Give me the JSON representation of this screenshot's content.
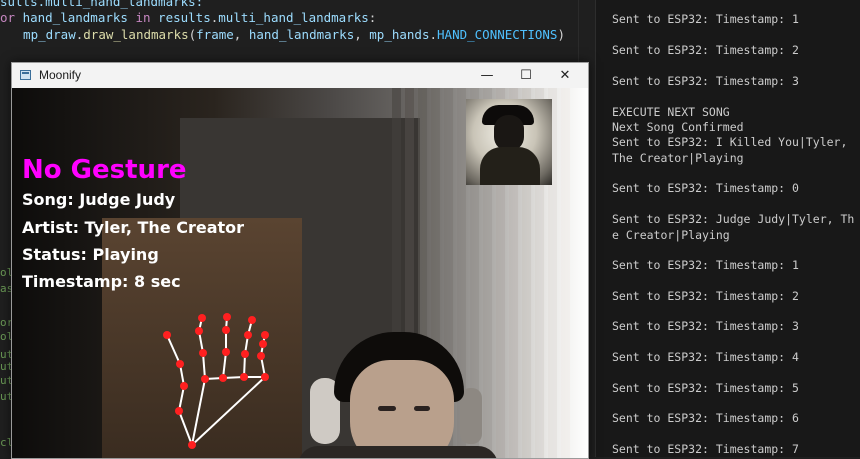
{
  "editor": {
    "lines": [
      {
        "parts": [
          {
            "t": "sults.multi_hand_landmarks:",
            "c": "vr"
          }
        ]
      },
      {
        "parts": [
          {
            "t": "or ",
            "c": "kw"
          },
          {
            "t": "hand_landmarks",
            "c": "vr"
          },
          {
            "t": " in ",
            "c": "kw"
          },
          {
            "t": "results",
            "c": "vr"
          },
          {
            "t": ".",
            "c": ""
          },
          {
            "t": "multi_hand_landmarks",
            "c": "vr"
          },
          {
            "t": ":",
            "c": ""
          }
        ]
      },
      {
        "parts": [
          {
            "t": "  mp_draw",
            "c": "vr"
          },
          {
            "t": ".",
            "c": ""
          },
          {
            "t": "draw_landmarks",
            "c": "fn"
          },
          {
            "t": "(",
            "c": ""
          },
          {
            "t": "frame",
            "c": "vr"
          },
          {
            "t": ", ",
            "c": ""
          },
          {
            "t": "hand_landmarks",
            "c": "vr"
          },
          {
            "t": ", ",
            "c": ""
          },
          {
            "t": "mp_hands",
            "c": "vr"
          },
          {
            "t": ".",
            "c": ""
          },
          {
            "t": "HAND_CONNECTIONS",
            "c": "cn"
          },
          {
            "t": ")",
            "c": ""
          }
        ]
      }
    ],
    "gutter_marks": [
      "ol",
      "as",
      "or",
      "ol",
      "ut",
      "ut",
      "ut",
      "ut",
      "cl"
    ]
  },
  "terminal": {
    "lines": [
      "Sent to ESP32: Timestamp: 1",
      "Sent to ESP32: Timestamp: 2",
      "Sent to ESP32: Timestamp: 3",
      "EXECUTE NEXT SONG",
      "Next Song Confirmed",
      "Sent to ESP32: I Killed You|Tyler, The Creator|Playing",
      "Sent to ESP32: Timestamp: 0",
      "Sent to ESP32: Judge Judy|Tyler, The Creator|Playing",
      "Sent to ESP32: Timestamp: 1",
      "Sent to ESP32: Timestamp: 2",
      "Sent to ESP32: Timestamp: 3",
      "Sent to ESP32: Timestamp: 4",
      "Sent to ESP32: Timestamp: 5",
      "Sent to ESP32: Timestamp: 6",
      "Sent to ESP32: Timestamp: 7"
    ]
  },
  "window": {
    "title": "Moonify",
    "minimize_glyph": "—",
    "maximize_glyph": "☐",
    "close_glyph": "✕"
  },
  "overlay": {
    "gesture": "No Gesture",
    "song": "Song: Judge Judy",
    "artist": "Artist: Tyler, The Creator",
    "status": "Status: Playing",
    "timestamp": "Timestamp: 8 sec"
  },
  "colors": {
    "gesture_text": "#ff00ff",
    "landmark_point": "#ff2020",
    "landmark_line": "#ffffff"
  }
}
